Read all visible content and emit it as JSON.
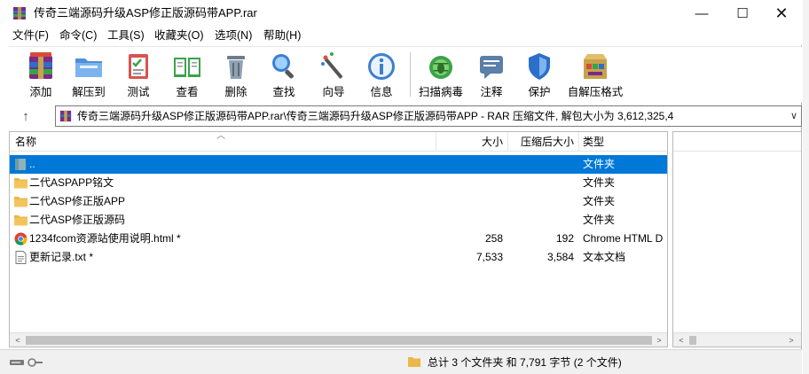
{
  "window": {
    "title": "传奇三端源码升级ASP修正版源码带APP.rar",
    "min_glyph": "—",
    "max_glyph": "☐",
    "close_glyph": "✕"
  },
  "menu": [
    "文件(F)",
    "命令(C)",
    "工具(S)",
    "收藏夹(O)",
    "选项(N)",
    "帮助(H)"
  ],
  "toolbar": {
    "add": "添加",
    "extract": "解压到",
    "test": "测试",
    "view": "查看",
    "delete": "删除",
    "find": "查找",
    "wizard": "向导",
    "info": "信息",
    "virus": "扫描病毒",
    "comment": "注释",
    "protect": "保护",
    "sfx": "自解压格式"
  },
  "address": {
    "up_glyph": "↑",
    "path": "传奇三端源码升级ASP修正版源码带APP.rar\\传奇三端源码升级ASP修正版源码带APP - RAR 压缩文件, 解包大小为 3,612,325,4",
    "dropdown_glyph": "∨"
  },
  "columns": {
    "name": "名称",
    "size": "大小",
    "packed": "压缩后大小",
    "type": "类型"
  },
  "files": [
    {
      "name": "..",
      "size": "",
      "packed": "",
      "type": "文件夹",
      "icon": "parent-folder-icon",
      "selected": true
    },
    {
      "name": "二代ASPAPP铭文",
      "size": "",
      "packed": "",
      "type": "文件夹",
      "icon": "folder-icon",
      "selected": false
    },
    {
      "name": "二代ASP修正版APP",
      "size": "",
      "packed": "",
      "type": "文件夹",
      "icon": "folder-icon",
      "selected": false
    },
    {
      "name": "二代ASP修正版源码",
      "size": "",
      "packed": "",
      "type": "文件夹",
      "icon": "folder-icon",
      "selected": false
    },
    {
      "name": "1234fcom资源站使用说明.html *",
      "size": "258",
      "packed": "192",
      "type": "Chrome HTML D",
      "icon": "chrome-icon",
      "selected": false
    },
    {
      "name": "更新记录.txt *",
      "size": "7,533",
      "packed": "3,584",
      "type": "文本文档",
      "icon": "text-file-icon",
      "selected": false
    }
  ],
  "scroll": {
    "left": "<",
    "right": ">"
  },
  "status": {
    "summary": "总计 3 个文件夹 和 7,791 字节 (2 个文件)"
  },
  "colors": {
    "selection": "#0078d7",
    "folder": "#f2c55c"
  }
}
